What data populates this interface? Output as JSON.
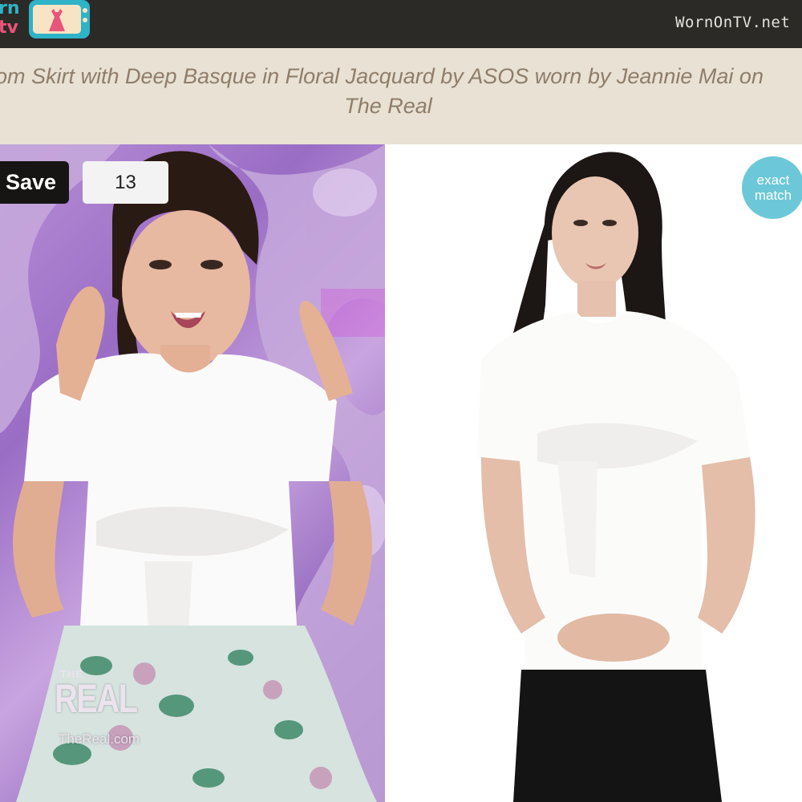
{
  "header": {
    "logo": {
      "line1": "rn",
      "line2": "tv",
      "icon": "dress-icon"
    },
    "site_name": "WornOnTV.net"
  },
  "title": {
    "line1": "om Skirt with Deep Basque in Floral Jacquard by ASOS worn by Jeannie Mai on",
    "line2": "The Real"
  },
  "left_photo": {
    "save_label": "Save",
    "save_count": "13",
    "watermark": {
      "the": "THE",
      "real": "REAL",
      "site": "TheReal.com"
    }
  },
  "right_photo": {
    "badge_line1": "exact",
    "badge_line2": "match"
  },
  "colors": {
    "topbar": "#2c2a27",
    "title_band": "#e8e1d4",
    "title_text": "#8f7d6a",
    "badge": "#6cc8d8",
    "save_button": "#161513"
  }
}
